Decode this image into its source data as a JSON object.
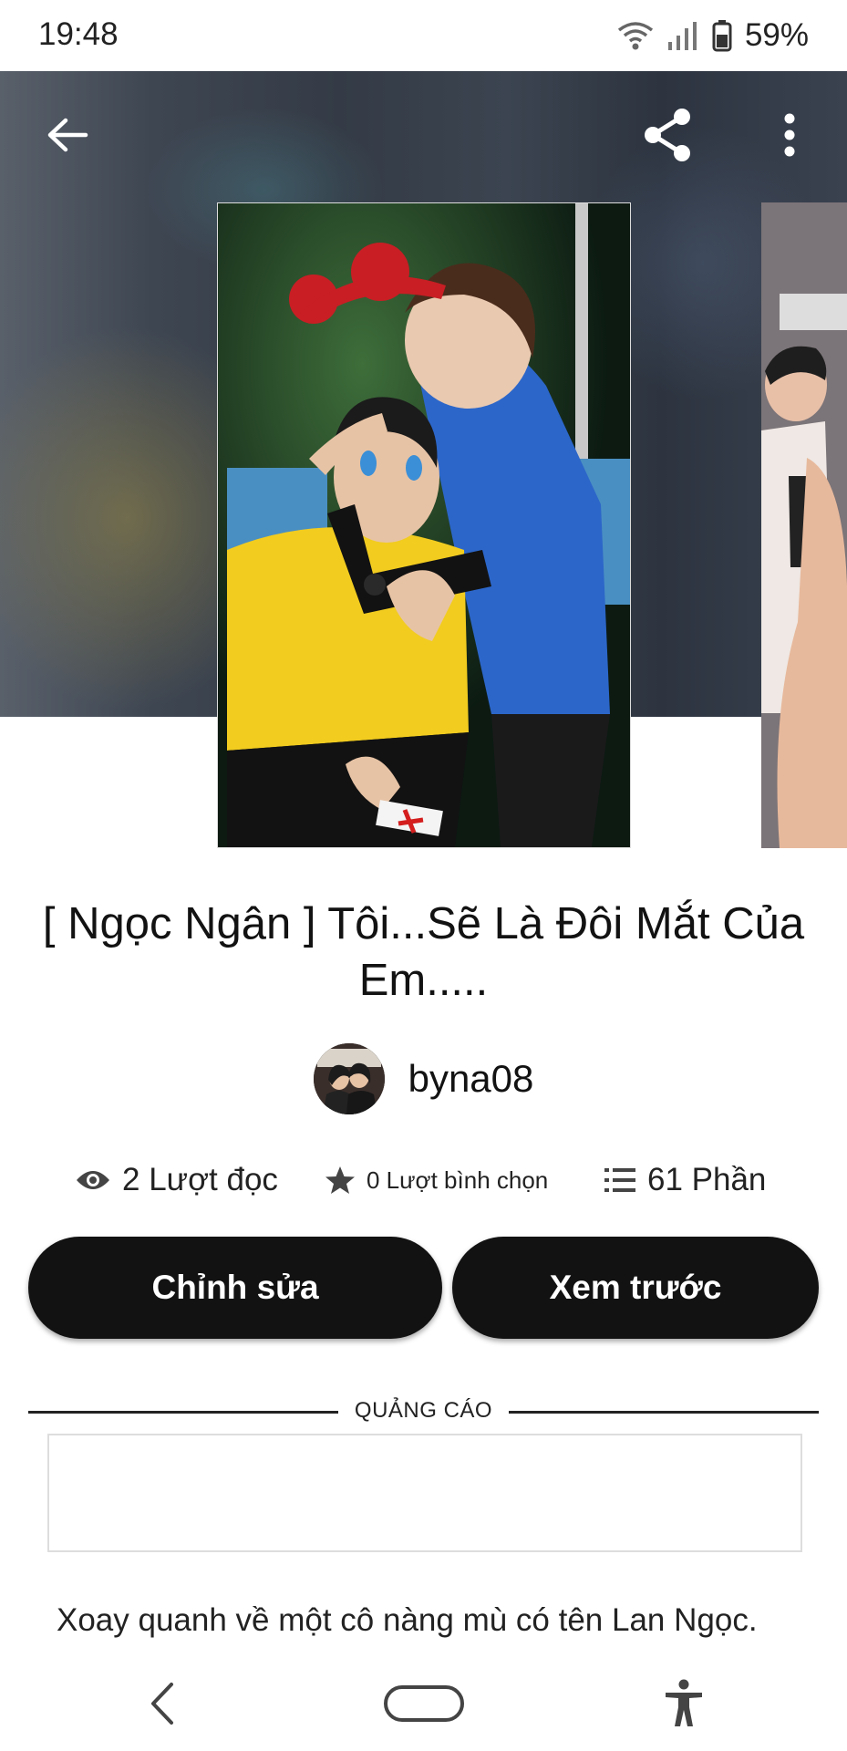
{
  "status_bar": {
    "time": "19:48",
    "battery": "59%",
    "icons": [
      "wifi-icon",
      "cell-signal-icon",
      "battery-icon"
    ]
  },
  "toolbar": {
    "back_icon": "arrow-left-icon",
    "share_icon": "share-icon",
    "more_icon": "more-vertical-icon"
  },
  "story": {
    "title": "[ Ngọc Ngân ] Tôi...Sẽ Là Đôi Mắt Của Em.....",
    "author": "byna08",
    "stats": {
      "reads": "2 Lượt đọc",
      "votes": "0 Lượt bình chọn",
      "parts": "61 Phần"
    },
    "description": "Xoay quanh về một cô nàng mù có tên Lan Ngọc."
  },
  "actions": {
    "edit_label": "Chỉnh sửa",
    "preview_label": "Xem trước"
  },
  "ad": {
    "label": "QUẢNG CÁO"
  },
  "nav": {
    "icons": [
      "back-nav-icon",
      "home-pill-icon",
      "accessibility-icon"
    ]
  },
  "colors": {
    "button_bg": "#121212",
    "button_text": "#ffffff",
    "text": "#121212"
  }
}
